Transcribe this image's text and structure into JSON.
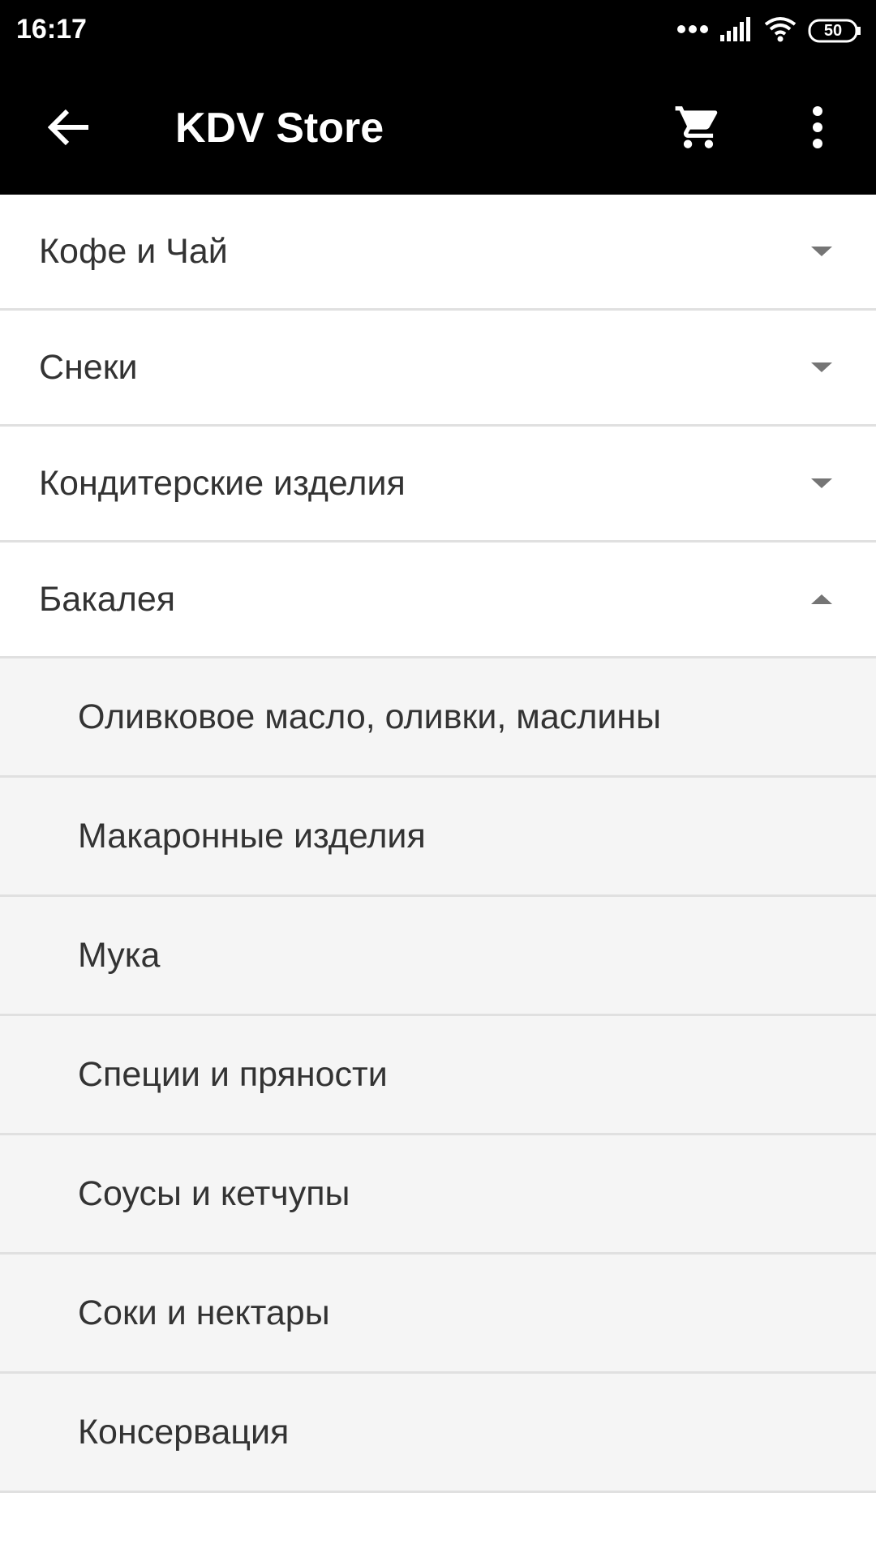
{
  "status_bar": {
    "time": "16:17",
    "battery": "50",
    "icons": [
      "dots-icon",
      "signal-icon",
      "wifi-icon",
      "battery-icon"
    ]
  },
  "toolbar": {
    "title": "KDV Store",
    "back_icon": "arrow-back-icon",
    "cart_icon": "cart-icon",
    "more_icon": "more-vert-icon"
  },
  "categories": [
    {
      "label": "Кофе и Чай",
      "expanded": false
    },
    {
      "label": "Снеки",
      "expanded": false
    },
    {
      "label": "Кондитерские изделия",
      "expanded": false
    },
    {
      "label": "Бакалея",
      "expanded": true
    }
  ],
  "subcategories": [
    {
      "label": "Оливковое масло, оливки, маслины"
    },
    {
      "label": "Макаронные изделия"
    },
    {
      "label": "Мука"
    },
    {
      "label": "Специи и пряности"
    },
    {
      "label": "Соусы и кетчупы"
    },
    {
      "label": "Соки и нектары"
    },
    {
      "label": "Консервация"
    }
  ],
  "colors": {
    "toolbar_bg": "#000000",
    "list_bg": "#ffffff",
    "sub_bg": "#f5f5f5",
    "divider": "#e0e0e0",
    "text": "#333333",
    "arrow": "#757575"
  }
}
